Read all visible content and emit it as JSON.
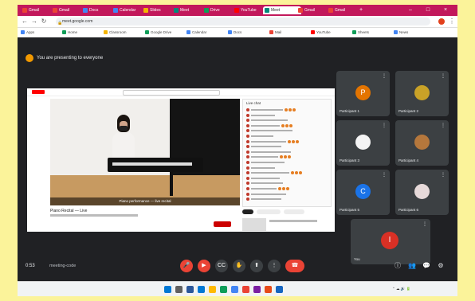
{
  "browser": {
    "tabs": [
      {
        "label": "Gmail",
        "color": "#ea4335"
      },
      {
        "label": "Gmail",
        "color": "#ea4335"
      },
      {
        "label": "Docs",
        "color": "#4285f4"
      },
      {
        "label": "Calendar",
        "color": "#4285f4"
      },
      {
        "label": "Slides",
        "color": "#f4b400"
      },
      {
        "label": "Meet",
        "color": "#00897b"
      },
      {
        "label": "Drive",
        "color": "#0f9d58"
      },
      {
        "label": "YouTube",
        "color": "#ff0000"
      },
      {
        "label": "Meet",
        "color": "#00897b"
      },
      {
        "label": "Gmail",
        "color": "#ea4335"
      },
      {
        "label": "Gmail",
        "color": "#ea4335"
      }
    ],
    "url": "meet.google.com",
    "bookmarks": [
      {
        "label": "Apps",
        "color": "#4285f4"
      },
      {
        "label": "Home",
        "color": "#0f9d58"
      },
      {
        "label": "Classroom",
        "color": "#f4b400"
      },
      {
        "label": "Google Drive",
        "color": "#0f9d58"
      },
      {
        "label": "Calendar",
        "color": "#4285f4"
      },
      {
        "label": "Docs",
        "color": "#4285f4"
      },
      {
        "label": "Mail",
        "color": "#ea4335"
      },
      {
        "label": "YouTube",
        "color": "#ff0000"
      },
      {
        "label": "Sheets",
        "color": "#0f9d58"
      },
      {
        "label": "News",
        "color": "#4285f4"
      }
    ]
  },
  "meet": {
    "presenter_banner": "You are presenting to everyone",
    "video": {
      "caption": "Piano performance — live recital",
      "title": "Piano Recital — Live",
      "chat_title": "Live chat"
    },
    "participants": [
      {
        "initial": "P",
        "name": "Participant 1",
        "color": "#e37400",
        "type": "letter"
      },
      {
        "initial": "",
        "name": "Participant 2",
        "color": "#5f6368",
        "type": "photo"
      },
      {
        "initial": "",
        "name": "Participant 3",
        "color": "#5f6368",
        "type": "photo"
      },
      {
        "initial": "",
        "name": "Participant 4",
        "color": "#5f6368",
        "type": "photo"
      },
      {
        "initial": "C",
        "name": "Participant 5",
        "color": "#1a73e8",
        "type": "letter"
      },
      {
        "initial": "",
        "name": "Participant 6",
        "color": "#5f6368",
        "type": "photo"
      }
    ],
    "self_tile": {
      "initial": "I",
      "name": "You",
      "color": "#d93025"
    },
    "bottom": {
      "time": "0:53",
      "code": "meeting-code"
    }
  },
  "icons": {
    "mic": "microphone-icon",
    "camera": "camera-icon",
    "captions": "captions-icon",
    "hand": "raise-hand-icon",
    "present": "present-screen-icon",
    "more": "more-options-icon",
    "end": "end-call-icon"
  }
}
